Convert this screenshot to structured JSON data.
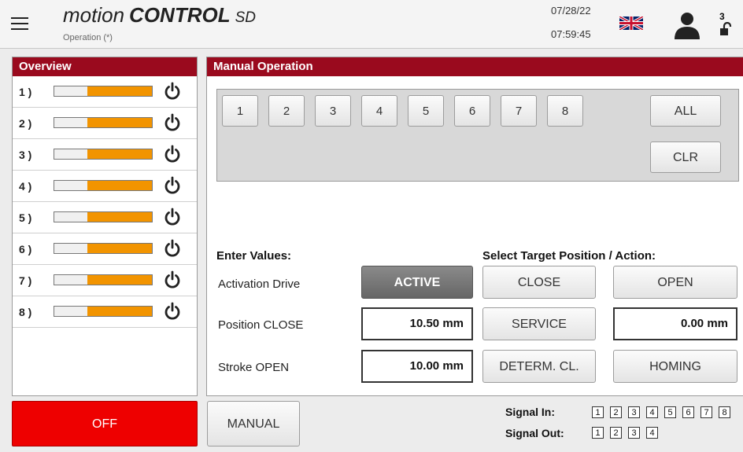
{
  "header": {
    "brand_part1": "motion",
    "brand_part2": "CONTROL",
    "brand_part3": "SD",
    "subtitle": "Operation (*)",
    "date": "07/28/22",
    "time": "07:59:45",
    "user_level": "3"
  },
  "overview": {
    "title": "Overview",
    "items": [
      {
        "label": "1 )",
        "level": 0.66
      },
      {
        "label": "2 )",
        "level": 0.66
      },
      {
        "label": "3 )",
        "level": 0.66
      },
      {
        "label": "4 )",
        "level": 0.66
      },
      {
        "label": "5 )",
        "level": 0.66
      },
      {
        "label": "6 )",
        "level": 0.66
      },
      {
        "label": "7 )",
        "level": 0.66
      },
      {
        "label": "8 )",
        "level": 0.66
      }
    ]
  },
  "manual": {
    "title": "Manual Operation",
    "axis_buttons": [
      "1",
      "2",
      "3",
      "4",
      "5",
      "6",
      "7",
      "8"
    ],
    "all_label": "ALL",
    "clr_label": "CLR",
    "enter_values_label": "Enter Values:",
    "activation_drive_label": "Activation Drive",
    "active_label": "ACTIVE",
    "position_close_label": "Position CLOSE",
    "position_close_value": "10.50  mm",
    "stroke_open_label": "Stroke OPEN",
    "stroke_open_value": "10.00  mm",
    "select_target_label": "Select Target Position / Action:",
    "close_label": "CLOSE",
    "open_label": "OPEN",
    "service_label": "SERVICE",
    "service_value": "0.00  mm",
    "determ_label": "DETERM. CL.",
    "homing_label": "HOMING"
  },
  "footer": {
    "off_label": "OFF",
    "manual_label": "MANUAL",
    "signal_in_label": "Signal In:",
    "signal_in": [
      "1",
      "2",
      "3",
      "4",
      "5",
      "6",
      "7",
      "8"
    ],
    "signal_out_label": "Signal Out:",
    "signal_out": [
      "1",
      "2",
      "3",
      "4"
    ]
  },
  "colors": {
    "accent": "#9a0a1e",
    "bar_fill": "#f29400",
    "off_button": "#ee0000"
  },
  "icons": [
    "menu-icon",
    "uk-flag-icon",
    "user-icon",
    "unlock-icon",
    "power-icon"
  ]
}
